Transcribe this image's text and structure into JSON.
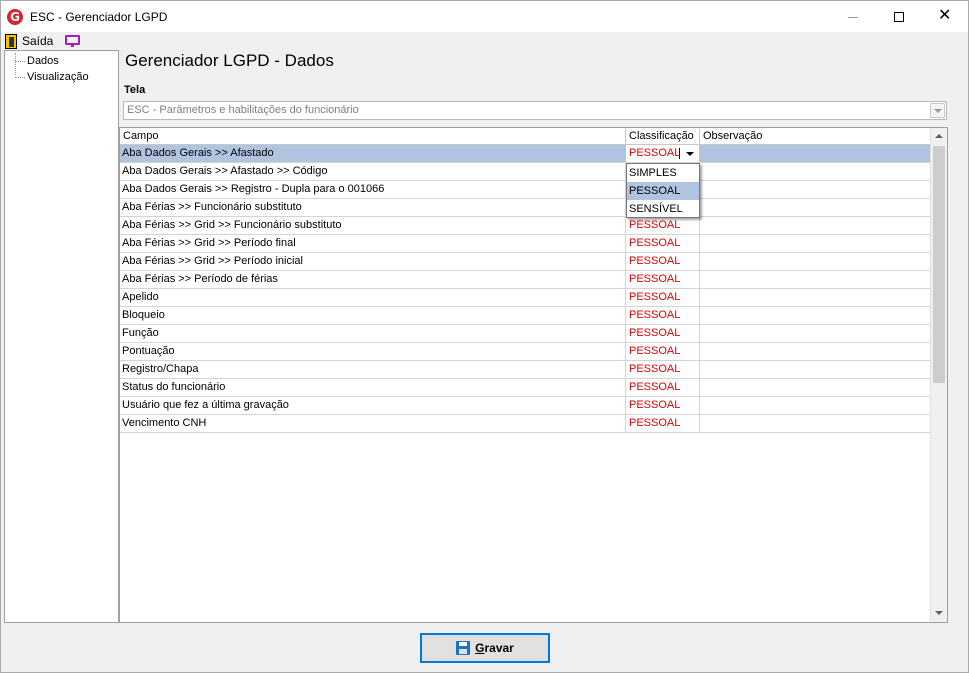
{
  "window": {
    "title": "ESC - Gerenciador LGPD",
    "app_icon_letter": "G",
    "close_glyph": "✕"
  },
  "menu": {
    "exit_label": "Saída"
  },
  "tree": {
    "items": [
      {
        "label": "Dados"
      },
      {
        "label": "Visualização"
      }
    ]
  },
  "main": {
    "title": "Gerenciador LGPD - Dados",
    "tela_label": "Tela",
    "tela_value": "ESC - Parâmetros e habilitações do funcionário"
  },
  "grid": {
    "columns": [
      "Campo",
      "Classificação",
      "Observação"
    ],
    "rows": [
      {
        "campo": "Aba Dados Gerais >> Afastado",
        "classificacao": "PESSOAL",
        "observacao": ""
      },
      {
        "campo": "Aba Dados Gerais >> Afastado >> Código",
        "classificacao": "",
        "observacao": ""
      },
      {
        "campo": "Aba Dados Gerais >> Registro - Dupla para o 001066",
        "classificacao": "",
        "observacao": ""
      },
      {
        "campo": "Aba Férias >> Funcionário substituto",
        "classificacao": "",
        "observacao": ""
      },
      {
        "campo": "Aba Férias >> Grid >> Funcionário substituto",
        "classificacao": "PESSOAL",
        "observacao": ""
      },
      {
        "campo": "Aba Férias >> Grid >> Período final",
        "classificacao": "PESSOAL",
        "observacao": ""
      },
      {
        "campo": "Aba Férias >> Grid >> Período inicial",
        "classificacao": "PESSOAL",
        "observacao": ""
      },
      {
        "campo": "Aba Férias >> Período de férias",
        "classificacao": "PESSOAL",
        "observacao": ""
      },
      {
        "campo": "Apelido",
        "classificacao": "PESSOAL",
        "observacao": ""
      },
      {
        "campo": "Bloqueio",
        "classificacao": "PESSOAL",
        "observacao": ""
      },
      {
        "campo": "Função",
        "classificacao": "PESSOAL",
        "observacao": ""
      },
      {
        "campo": "Pontuação",
        "classificacao": "PESSOAL",
        "observacao": ""
      },
      {
        "campo": "Registro/Chapa",
        "classificacao": "PESSOAL",
        "observacao": ""
      },
      {
        "campo": "Status do funcionário",
        "classificacao": "PESSOAL",
        "observacao": ""
      },
      {
        "campo": "Usuário que fez a última gravação",
        "classificacao": "PESSOAL",
        "observacao": ""
      },
      {
        "campo": "Vencimento CNH",
        "classificacao": "PESSOAL",
        "observacao": ""
      }
    ],
    "dropdown_options": [
      "SIMPLES",
      "PESSOAL",
      "SENSÍVEL"
    ],
    "dropdown_highlighted": "PESSOAL"
  },
  "footer": {
    "save_label_first": "G",
    "save_label_rest": "ravar"
  },
  "colors": {
    "classification_text": "#e00000",
    "selection": "#b0c4e0",
    "primary_button_border": "#0078d7"
  }
}
